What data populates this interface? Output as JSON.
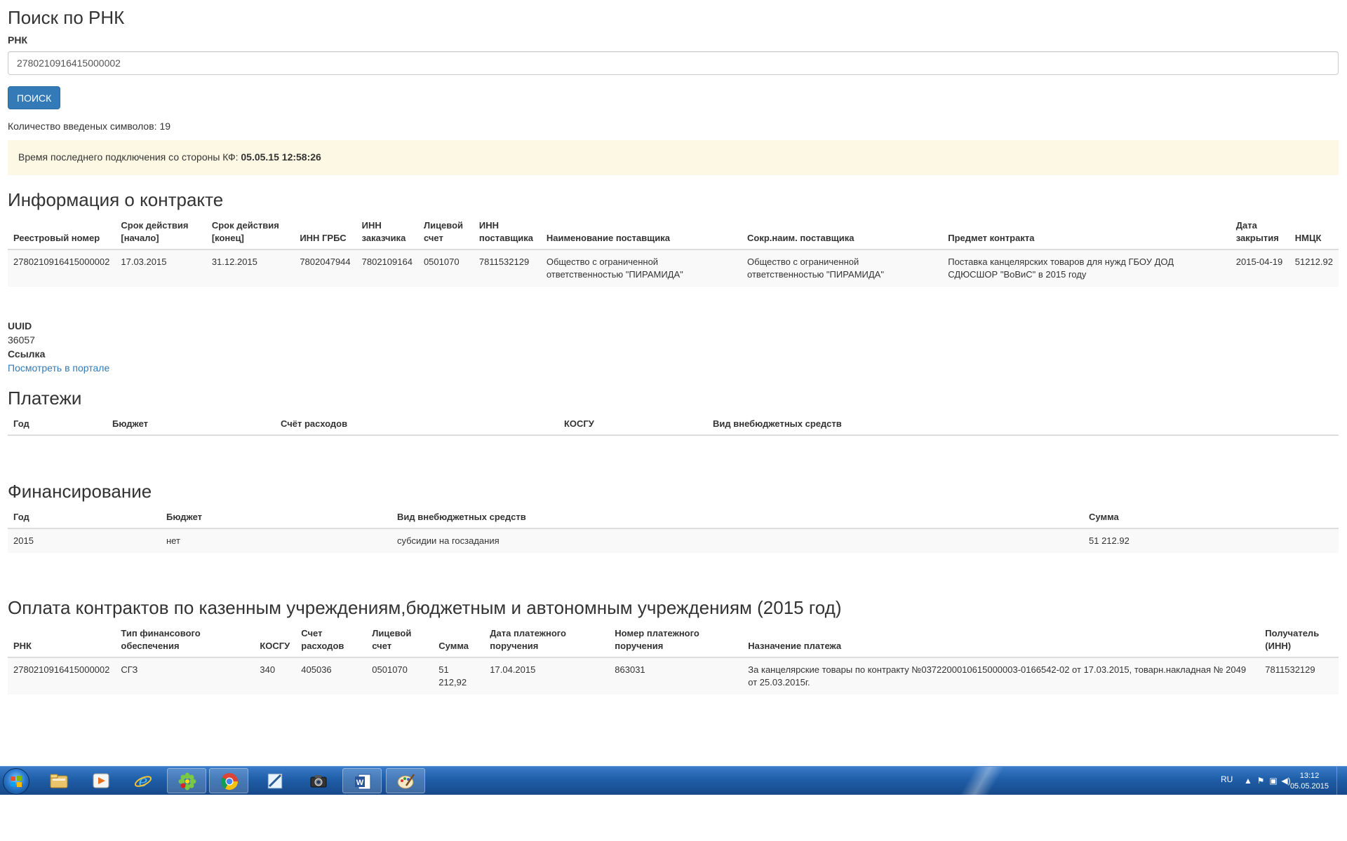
{
  "search": {
    "title": "Поиск по РНК",
    "field_label": "РНК",
    "value": "2780210916415000002",
    "button_label": "ПОИСК",
    "chars_text": "Количество введеных символов: 19"
  },
  "alert": {
    "text": "Время последнего подключения со стороны КФ: ",
    "time": "05.05.15 12:58:26"
  },
  "contract": {
    "title": "Информация о контракте",
    "headers": [
      "Реестровый номер",
      "Срок действия [начало]",
      "Срок действия [конец]",
      "ИНН ГРБС",
      "ИНН заказчика",
      "Лицевой счет",
      "ИНН поставщика",
      "Наименование поставщика",
      "Сокр.наим. поставщика",
      "Предмет контракта",
      "Дата закрытия",
      "НМЦК"
    ],
    "row": [
      "2780210916415000002",
      "17.03.2015",
      "31.12.2015",
      "7802047944",
      "7802109164",
      "0501070",
      "7811532129",
      "Общество с ограниченной ответственностью \"ПИРАМИДА\"",
      "Общество с ограниченной ответственностью \"ПИРАМИДА\"",
      "Поставка канцелярских товаров для нужд ГБОУ ДОД СДЮСШОР \"ВоВиС\" в 2015 году",
      "2015-04-19",
      "51212.92"
    ]
  },
  "uuid": {
    "uuid_label": "UUID",
    "uuid_value": "36057",
    "link_label": "Ссылка",
    "link_text": "Посмотреть в портале"
  },
  "payments": {
    "title": "Платежи",
    "headers": [
      "Год",
      "Бюджет",
      "Счёт расходов",
      "КОСГУ",
      "Вид внебюджетных средств"
    ]
  },
  "financing": {
    "title": "Финансирование",
    "headers": [
      "Год",
      "Бюджет",
      "Вид внебюджетных средств",
      "Сумма"
    ],
    "row": [
      "2015",
      "нет",
      "субсидии на госзадания",
      "51 212.92"
    ]
  },
  "oplata": {
    "title": "Оплата контрактов по казенным учреждениям,бюджетным и автономным учреждениям (2015 год)",
    "headers": [
      "РНК",
      "Тип финансового обеспечения",
      "КОСГУ",
      "Счет расходов",
      "Лицевой счет",
      "Сумма",
      "Дата платежного поручения",
      "Номер платежного поручения",
      "Назначение платежа",
      "Получатель (ИНН)"
    ],
    "row": [
      "2780210916415000002",
      "СГЗ",
      "340",
      "405036",
      "0501070",
      "51 212,92",
      "17.04.2015",
      "863031",
      "За канцелярские товары по контракту №0372200010615000003-0166542-02 от 17.03.2015, товарн.накладная № 2049 от 25.03.2015г.",
      "7811532129"
    ]
  },
  "taskbar": {
    "apps": [
      "folder-icon",
      "media-player-icon",
      "internet-explorer-icon",
      "icq-icon",
      "chrome-icon",
      "notepad-icon",
      "camera-icon",
      "word-icon",
      "paint-icon"
    ],
    "lang": "RU",
    "time": "13:12",
    "date": "05.05.2015"
  },
  "colors": {
    "primary": "#337ab7",
    "alert_bg": "#fcf8e3",
    "striped_row": "#f9f9f9",
    "taskbar": "#1f5ea8"
  }
}
